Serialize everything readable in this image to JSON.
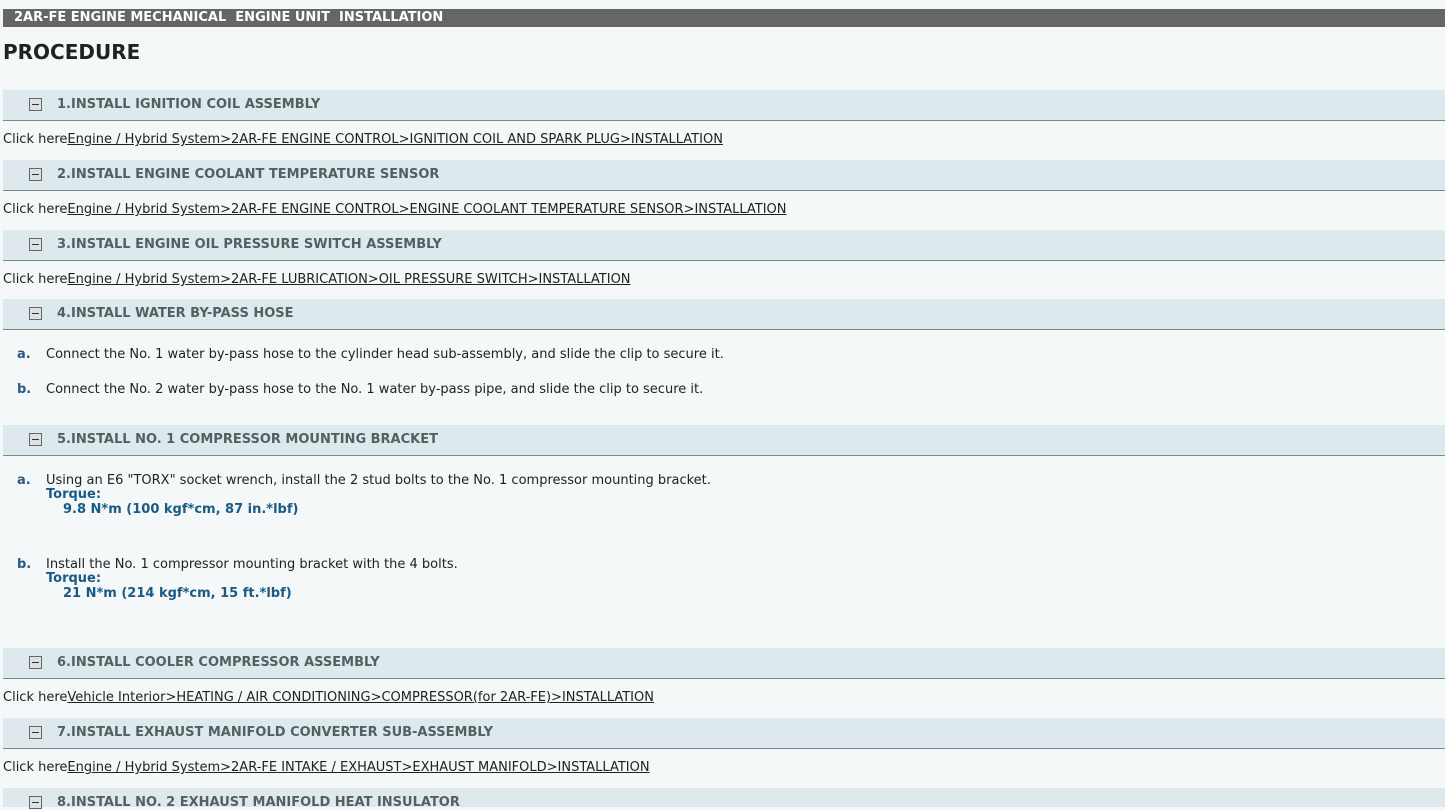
{
  "header": {
    "title": "2AR-FE ENGINE MECHANICAL  ENGINE UNIT  INSTALLATION"
  },
  "page_title": "PROCEDURE",
  "click_here": "Click here",
  "sections": [
    {
      "title": "1.INSTALL IGNITION COIL ASSEMBLY",
      "link": "Engine / Hybrid System>2AR-FE ENGINE CONTROL>IGNITION COIL AND SPARK PLUG>INSTALLATION"
    },
    {
      "title": "2.INSTALL ENGINE COOLANT TEMPERATURE SENSOR",
      "link": "Engine / Hybrid System>2AR-FE ENGINE CONTROL>ENGINE COOLANT TEMPERATURE SENSOR>INSTALLATION"
    },
    {
      "title": "3.INSTALL ENGINE OIL PRESSURE SWITCH ASSEMBLY",
      "link": "Engine / Hybrid System>2AR-FE LUBRICATION>OIL PRESSURE SWITCH>INSTALLATION"
    },
    {
      "title": "4.INSTALL WATER BY-PASS HOSE",
      "steps": [
        {
          "letter": "a.",
          "text": "Connect the No. 1 water by-pass hose to the cylinder head sub-assembly, and slide the clip to secure it."
        },
        {
          "letter": "b.",
          "text": "Connect the No. 2 water by-pass hose to the No. 1 water by-pass pipe, and slide the clip to secure it."
        }
      ]
    },
    {
      "title": "5.INSTALL NO. 1 COMPRESSOR MOUNTING BRACKET",
      "steps": [
        {
          "letter": "a.",
          "text": "Using an E6 \"TORX\" socket wrench, install the 2 stud bolts to the No. 1 compressor mounting bracket.",
          "torque_label": "Torque:",
          "torque_value": "9.8 N*m (100 kgf*cm, 87 in.*lbf)"
        },
        {
          "letter": "b.",
          "text": "Install the No. 1 compressor mounting bracket with the 4 bolts.",
          "torque_label": "Torque:",
          "torque_value": "21 N*m (214 kgf*cm, 15 ft.*lbf)"
        }
      ]
    },
    {
      "title": "6.INSTALL COOLER COMPRESSOR ASSEMBLY",
      "link": "Vehicle Interior>HEATING / AIR CONDITIONING>COMPRESSOR(for 2AR-FE)>INSTALLATION"
    },
    {
      "title": "7.INSTALL EXHAUST MANIFOLD CONVERTER SUB-ASSEMBLY",
      "link": "Engine / Hybrid System>2AR-FE INTAKE / EXHAUST>EXHAUST MANIFOLD>INSTALLATION"
    },
    {
      "title": "8.INSTALL NO. 2 EXHAUST MANIFOLD HEAT INSULATOR"
    }
  ]
}
